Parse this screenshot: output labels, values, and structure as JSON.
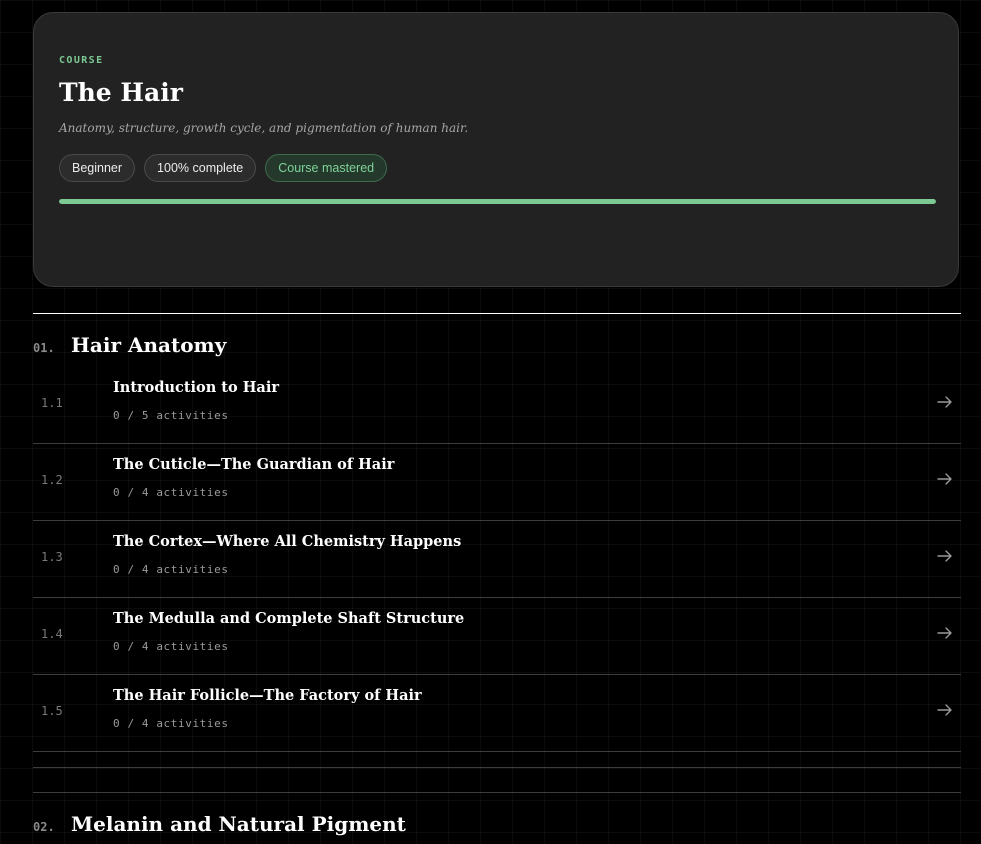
{
  "course": {
    "eyebrow": "COURSE",
    "title": "The Hair",
    "description": "Anatomy, structure, growth cycle, and pigmentation of human hair.",
    "level": "Beginner",
    "progress_label": "100% complete",
    "status_label": "Course mastered",
    "progress_fraction": 1.0
  },
  "sections": [
    {
      "number": "01.",
      "title": "Hair Anatomy",
      "lessons": [
        {
          "number": "1.1",
          "title": "Introduction to Hair",
          "meta": "0 / 5 activities",
          "icon": "arrow-right-icon"
        },
        {
          "number": "1.2",
          "title": "The Cuticle—The Guardian of Hair",
          "meta": "0 / 4 activities",
          "icon": "arrow-right-icon"
        },
        {
          "number": "1.3",
          "title": "The Cortex—Where All Chemistry Happens",
          "meta": "0 / 4 activities",
          "icon": "arrow-right-icon"
        },
        {
          "number": "1.4",
          "title": "The Medulla and Complete Shaft Structure",
          "meta": "0 / 4 activities",
          "icon": "arrow-right-icon"
        },
        {
          "number": "1.5",
          "title": "The Hair Follicle—The Factory of Hair",
          "meta": "0 / 4 activities",
          "icon": "arrow-right-icon"
        }
      ]
    },
    {
      "number": "02.",
      "title": "Melanin and Natural Pigment"
    }
  ],
  "colors": {
    "accent": "#7cc993",
    "background": "#000000",
    "card": "#222222"
  }
}
